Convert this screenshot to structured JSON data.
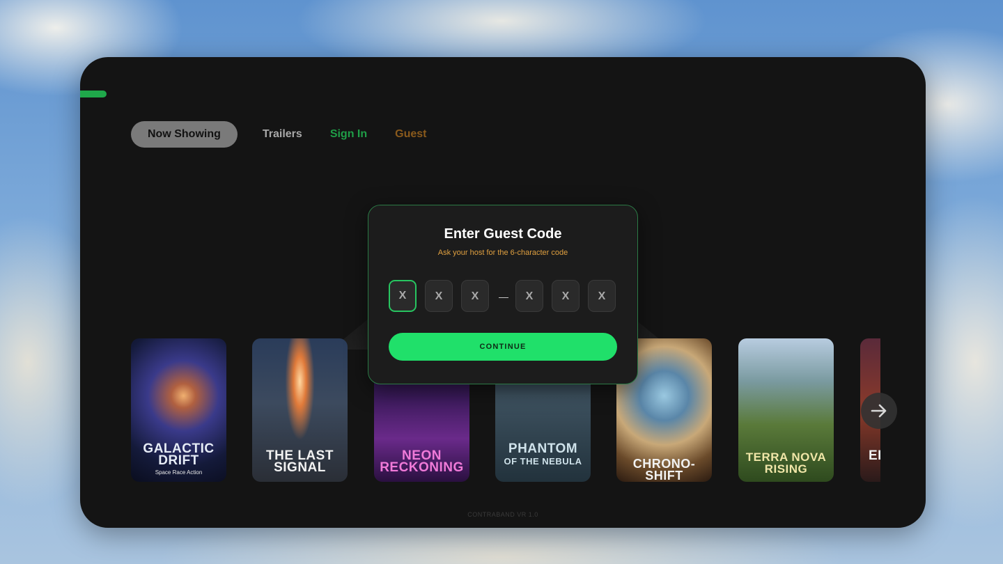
{
  "nav": {
    "now_showing": "Now Showing",
    "trailers": "Trailers",
    "sign_in": "Sign In",
    "guest": "Guest"
  },
  "modal": {
    "title": "Enter Guest Code",
    "subtitle": "Ask your host for the 6-character code",
    "code_chars": [
      "X",
      "X",
      "X",
      "X",
      "X",
      "X"
    ],
    "separator": "—",
    "continue_label": "CONTINUE"
  },
  "movies": [
    {
      "title_line1": "GALACTIC",
      "title_line2": "DRIFT",
      "tagline": "Space Race Action"
    },
    {
      "title_line1": "THE LAST",
      "title_line2": "SIGNAL"
    },
    {
      "title_line1": "NEON",
      "title_line2": "RECKONING"
    },
    {
      "title_line1": "PHANTOM",
      "title_line2": "OF THE NEBULA"
    },
    {
      "title_line1": "CHRONO-SHIFT",
      "title_line2": ""
    },
    {
      "title_line1": "TERRA NOVA",
      "title_line2": "RISING"
    },
    {
      "title_line1": "EI",
      "title_line2": ""
    }
  ],
  "footer": {
    "version": "CONTRABAND VR 1.0"
  },
  "colors": {
    "accent_green": "#20e06a",
    "sign_in_green": "#1f9e47",
    "guest_orange": "#8a5a1c",
    "subtitle_orange": "#e0a040",
    "panel_bg": "#141414"
  },
  "icons": {
    "next": "arrow-right-icon"
  }
}
